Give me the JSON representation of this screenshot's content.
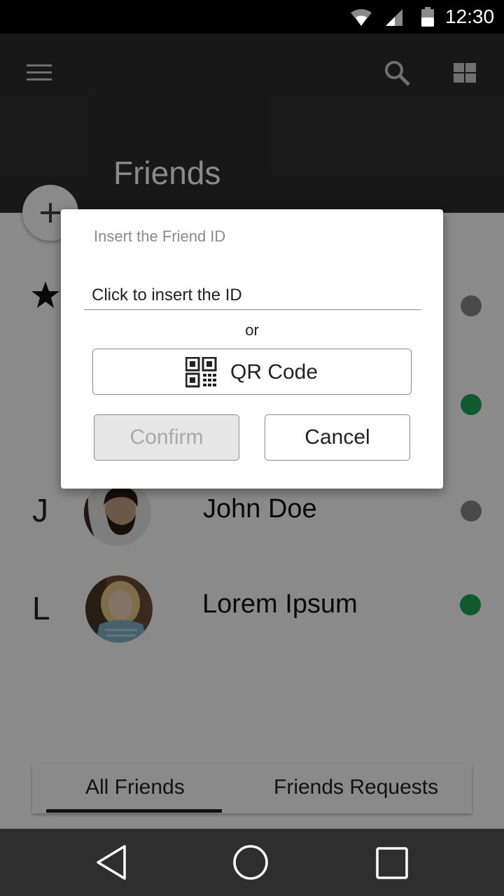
{
  "status_bar": {
    "time": "12:30"
  },
  "app_bar": {
    "title": "Friends",
    "menu_icon": "menu-icon",
    "search_icon": "search-icon",
    "grid_icon": "grid-view-icon"
  },
  "fab": {
    "icon": "plus-icon"
  },
  "friends": [
    {
      "section": "J",
      "name": "John Doe",
      "status": "offline",
      "status_color": "#8a8a8a"
    },
    {
      "section": "L",
      "name": "Lorem Ipsum",
      "status": "online",
      "status_color": "#1fa854"
    }
  ],
  "tabs": [
    {
      "label": "All Friends",
      "active": true
    },
    {
      "label": "Friends Requests",
      "active": false
    }
  ],
  "dialog": {
    "title": "Insert the Friend ID",
    "input_placeholder": "Click to insert the ID",
    "or_text": "or",
    "qr_button_label": "QR Code",
    "confirm_label": "Confirm",
    "cancel_label": "Cancel"
  },
  "colors": {
    "app_bar": "#2e2e2e",
    "online": "#1fa854",
    "offline": "#8a8a8a"
  }
}
